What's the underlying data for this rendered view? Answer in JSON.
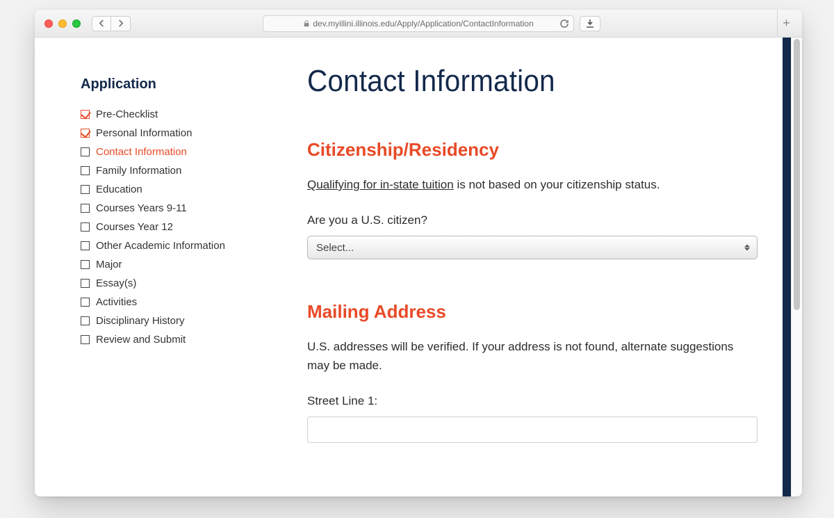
{
  "browser": {
    "url": "dev.myillini.illinois.edu/Apply/Application/ContactInformation"
  },
  "sidebar": {
    "title": "Application",
    "items": [
      {
        "label": "Pre-Checklist",
        "checked": true,
        "active": false
      },
      {
        "label": "Personal Information",
        "checked": true,
        "active": false
      },
      {
        "label": "Contact Information",
        "checked": false,
        "active": true
      },
      {
        "label": "Family Information",
        "checked": false,
        "active": false
      },
      {
        "label": "Education",
        "checked": false,
        "active": false
      },
      {
        "label": "Courses Years 9-11",
        "checked": false,
        "active": false
      },
      {
        "label": "Courses Year 12",
        "checked": false,
        "active": false
      },
      {
        "label": "Other Academic Information",
        "checked": false,
        "active": false
      },
      {
        "label": "Major",
        "checked": false,
        "active": false
      },
      {
        "label": "Essay(s)",
        "checked": false,
        "active": false
      },
      {
        "label": "Activities",
        "checked": false,
        "active": false
      },
      {
        "label": "Disciplinary History",
        "checked": false,
        "active": false
      },
      {
        "label": "Review and Submit",
        "checked": false,
        "active": false
      }
    ]
  },
  "main": {
    "title": "Contact Information",
    "citizenship": {
      "heading": "Citizenship/Residency",
      "link_text": "Qualifying for in-state tuition",
      "desc_rest": " is not based on your citizenship status.",
      "question": "Are you a U.S. citizen?",
      "select_placeholder": "Select..."
    },
    "mailing": {
      "heading": "Mailing Address",
      "desc": "U.S. addresses will be verified. If your address is not found, alternate suggestions may be made.",
      "street1_label": "Street Line 1:"
    }
  }
}
